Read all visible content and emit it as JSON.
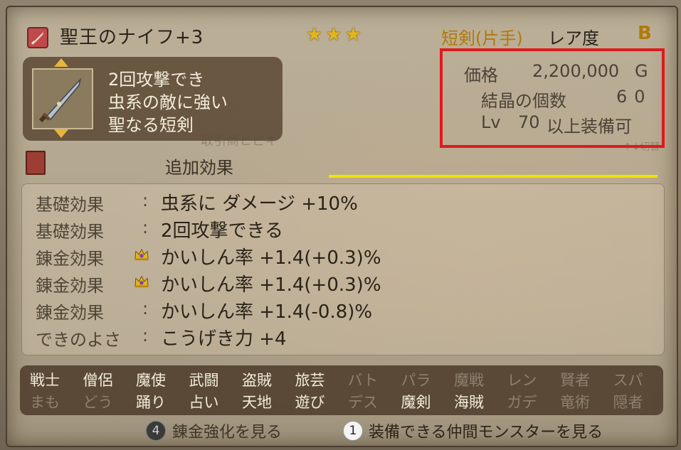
{
  "item": {
    "name": "聖王のナイフ+3",
    "stars": "★★★",
    "category": "短剣(片手)",
    "rarity_label": "レア度",
    "rarity_grade": "B",
    "description": [
      "2回攻撃でき",
      "虫系の敵に強い",
      "聖なる短剣"
    ]
  },
  "info": {
    "price_label": "価格",
    "price_value": "2,200,000",
    "price_unit": "G",
    "crystal_label": "結晶の個数",
    "crystal_value": "60",
    "level_label": "Lv",
    "level_value": "70",
    "level_suffix": "以上装備可"
  },
  "section": {
    "additional_effects": "追加効果"
  },
  "effects": [
    {
      "label": "基礎効果",
      "sep": ":",
      "value": "虫系に ダメージ +10%",
      "crown": false
    },
    {
      "label": "基礎効果",
      "sep": ":",
      "value": "2回攻撃できる",
      "crown": false
    },
    {
      "label": "錬金効果",
      "sep": "",
      "value": "かいしん率 +1.4(+0.3)%",
      "crown": true
    },
    {
      "label": "錬金効果",
      "sep": "",
      "value": "かいしん率 +1.4(+0.3)%",
      "crown": true
    },
    {
      "label": "錬金効果",
      "sep": ":",
      "value": "かいしん率 +1.4(-0.8)%",
      "crown": false
    },
    {
      "label": "できのよさ",
      "sep": ":",
      "value": "こうげき力 +4",
      "crown": false
    }
  ],
  "jobs": [
    {
      "label": "戦士",
      "enabled": true
    },
    {
      "label": "僧侶",
      "enabled": true
    },
    {
      "label": "魔使",
      "enabled": true
    },
    {
      "label": "武闘",
      "enabled": true
    },
    {
      "label": "盗賊",
      "enabled": true
    },
    {
      "label": "旅芸",
      "enabled": true
    },
    {
      "label": "バト",
      "enabled": false
    },
    {
      "label": "パラ",
      "enabled": false
    },
    {
      "label": "魔戦",
      "enabled": false
    },
    {
      "label": "レン",
      "enabled": false
    },
    {
      "label": "賢者",
      "enabled": false
    },
    {
      "label": "スパ",
      "enabled": false
    },
    {
      "label": "まも",
      "enabled": false
    },
    {
      "label": "どう",
      "enabled": false
    },
    {
      "label": "踊り",
      "enabled": true
    },
    {
      "label": "占い",
      "enabled": true
    },
    {
      "label": "天地",
      "enabled": true
    },
    {
      "label": "遊び",
      "enabled": true
    },
    {
      "label": "デス",
      "enabled": false
    },
    {
      "label": "魔剣",
      "enabled": true
    },
    {
      "label": "海賊",
      "enabled": true
    },
    {
      "label": "ガデ",
      "enabled": false
    },
    {
      "label": "竜術",
      "enabled": false
    },
    {
      "label": "隠者",
      "enabled": false
    }
  ],
  "buttons": {
    "alchemy_key": "4",
    "alchemy_label": "錬金強化を見る",
    "monster_key": "1",
    "monster_label": "装備できる仲間モンスターを見る"
  },
  "background_text": [
    "取引商ヒピキ",
    "↑↓切替"
  ],
  "colors": {
    "highlight_box": "#e0191c",
    "underline": "#f2e200",
    "stars": "#e2b51c",
    "category": "#b07a08"
  }
}
